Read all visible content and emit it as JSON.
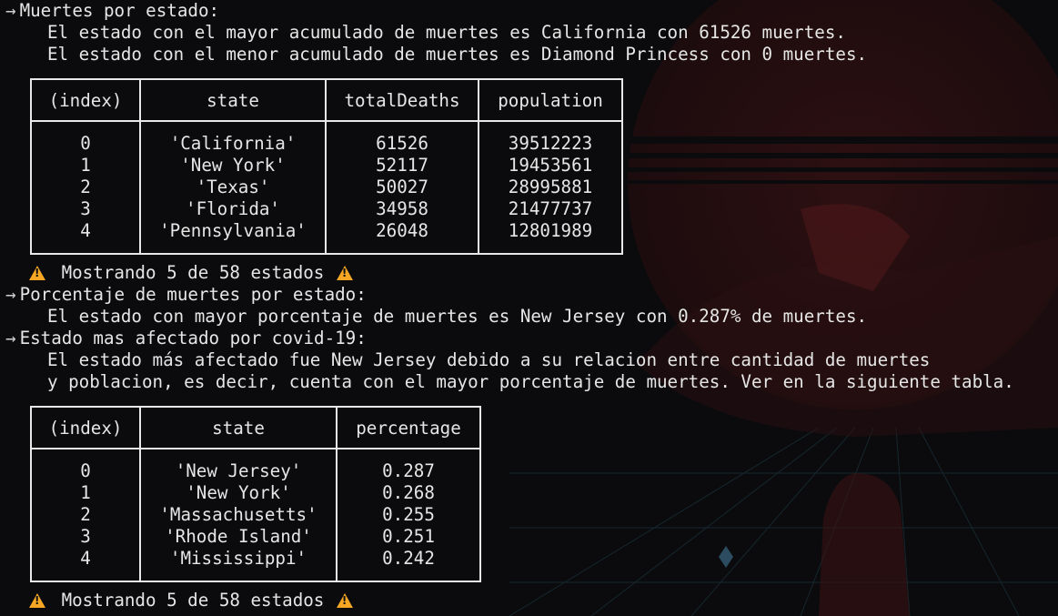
{
  "sections": [
    {
      "arrow": "→",
      "title": "Muertes por estado:"
    },
    {
      "arrow": "→",
      "title": "Porcentaje de muertes por estado:"
    },
    {
      "arrow": "→",
      "title": "Estado mas afectado por covid-19:"
    }
  ],
  "deaths": {
    "max_line": "El estado con el mayor acumulado de muertes es California con 61526 muertes.",
    "min_line": "El estado con el menor acumulado de muertes es Diamond Princess con 0 muertes.",
    "table": {
      "headers": [
        "(index)",
        "state",
        "totalDeaths",
        "population"
      ],
      "rows": [
        [
          "0",
          "'California'",
          "61526",
          "39512223"
        ],
        [
          "1",
          "'New York'",
          "52117",
          "19453561"
        ],
        [
          "2",
          "'Texas'",
          "50027",
          "28995881"
        ],
        [
          "3",
          "'Florida'",
          "34958",
          "21477737"
        ],
        [
          "4",
          "'Pennsylvania'",
          "26048",
          "12801989"
        ]
      ]
    }
  },
  "showing_1": "Mostrando 5 de 58 estados",
  "percentage_line": "El estado con mayor porcentaje de muertes es New Jersey con 0.287% de muertes.",
  "affected": {
    "line1": "El estado más afectado fue New Jersey debido a su relacion entre cantidad de muertes",
    "line2": "y poblacion, es decir, cuenta con el mayor porcentaje de muertes. Ver en la siguiente tabla.",
    "table": {
      "headers": [
        "(index)",
        "state",
        "percentage"
      ],
      "rows": [
        [
          "0",
          "'New Jersey'",
          "0.287"
        ],
        [
          "1",
          "'New York'",
          "0.268"
        ],
        [
          "2",
          "'Massachusetts'",
          "0.255"
        ],
        [
          "3",
          "'Rhode Island'",
          "0.251"
        ],
        [
          "4",
          "'Mississippi'",
          "0.242"
        ]
      ]
    }
  },
  "showing_2": "Mostrando 5 de 58 estados",
  "icons": {
    "warning": "warning-icon",
    "arrow": "arrow-right-icon"
  },
  "colors": {
    "string": "#23b47a",
    "number": "#d9c93a",
    "text": "#e6e6e6",
    "warning": "#f5a623",
    "background": "#0b0b0d"
  }
}
